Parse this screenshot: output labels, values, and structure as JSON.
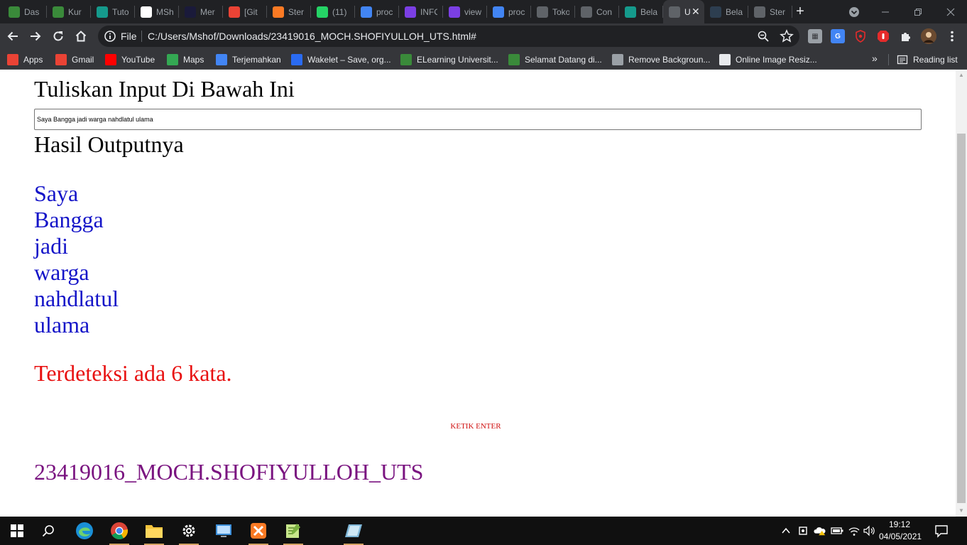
{
  "tabs": [
    {
      "title": "Das",
      "icon": "moodle-icon",
      "color": "#3a8a3a"
    },
    {
      "title": "Kur",
      "icon": "moodle-icon",
      "color": "#3a8a3a"
    },
    {
      "title": "Tuto",
      "icon": "tutorial-icon",
      "color": "#159a8c"
    },
    {
      "title": "MSh",
      "icon": "github-icon",
      "color": "#ffffff"
    },
    {
      "title": "Mer",
      "icon": "vimeo-icon",
      "color": "#1a1a3a"
    },
    {
      "title": "[Git",
      "icon": "gmail-icon",
      "color": "#ea4335"
    },
    {
      "title": "Ster",
      "icon": "xampp-icon",
      "color": "#fb7a24"
    },
    {
      "title": "(11)",
      "icon": "whatsapp-icon",
      "color": "#25d366"
    },
    {
      "title": "proc",
      "icon": "google-icon",
      "color": "#4285f4"
    },
    {
      "title": "INFO",
      "icon": "bookmark-icon",
      "color": "#7b3fe4"
    },
    {
      "title": "view",
      "icon": "bookmark-icon",
      "color": "#7b3fe4"
    },
    {
      "title": "proc",
      "icon": "google-icon",
      "color": "#4285f4"
    },
    {
      "title": "Toko",
      "icon": "globe-icon",
      "color": "#5f6368"
    },
    {
      "title": "Con",
      "icon": "globe-icon",
      "color": "#5f6368"
    },
    {
      "title": "Bela",
      "icon": "tutorial-icon",
      "color": "#159a8c"
    },
    {
      "title": "U",
      "icon": "globe-icon",
      "color": "#5f6368",
      "active": true
    },
    {
      "title": "Bela",
      "icon": "dicoding-icon",
      "color": "#2d3e50"
    },
    {
      "title": "Ster",
      "icon": "globe-icon",
      "color": "#5f6368"
    }
  ],
  "toolbar": {
    "scheme": "File",
    "url": "C:/Users/Mshof/Downloads/23419016_MOCH.SHOFIYULLOH_UTS.html#"
  },
  "bookmarks": [
    {
      "label": "Apps",
      "icon": "apps-grid-icon",
      "color": "#ea4335"
    },
    {
      "label": "Gmail",
      "icon": "gmail-icon",
      "color": "#ea4335"
    },
    {
      "label": "YouTube",
      "icon": "youtube-icon",
      "color": "#ff0000"
    },
    {
      "label": "Maps",
      "icon": "maps-icon",
      "color": "#34a853"
    },
    {
      "label": "Terjemahkan",
      "icon": "translate-icon",
      "color": "#4285f4"
    },
    {
      "label": "Wakelet – Save, org...",
      "icon": "wakelet-icon",
      "color": "#2a6bf2"
    },
    {
      "label": "ELearning Universit...",
      "icon": "moodle-icon",
      "color": "#3a8a3a"
    },
    {
      "label": "Selamat Datang di...",
      "icon": "moodle-icon",
      "color": "#3a8a3a"
    },
    {
      "label": "Remove Backgroun...",
      "icon": "layers-icon",
      "color": "#9aa0a6"
    },
    {
      "label": "Online Image Resiz...",
      "icon": "globe-icon",
      "color": "#e8eaed"
    }
  ],
  "bookmarks_more": "»",
  "reading_list": "Reading list",
  "page": {
    "heading_input": "Tuliskan Input Di Bawah Ini",
    "input_value": "Saya Bangga jadi warga nahdlatul ulama",
    "heading_output": "Hasil Outputnya",
    "words": [
      "Saya",
      "Bangga",
      "jadi",
      "warga",
      "nahdlatul",
      "ulama"
    ],
    "count_text": "Terdeteksi ada 6 kata.",
    "hint": "KETIK ENTER",
    "footer_title": "23419016_MOCH.SHOFIYULLOH_UTS"
  },
  "taskbar": {
    "apps": [
      "windows-start-icon",
      "search-icon",
      "edge-icon",
      "chrome-icon",
      "file-explorer-icon",
      "settings-icon",
      "remote-desktop-icon",
      "xampp-icon",
      "notepad-plus-icon",
      "tablet-app-icon"
    ],
    "time": "19:12",
    "date": "04/05/2021"
  }
}
